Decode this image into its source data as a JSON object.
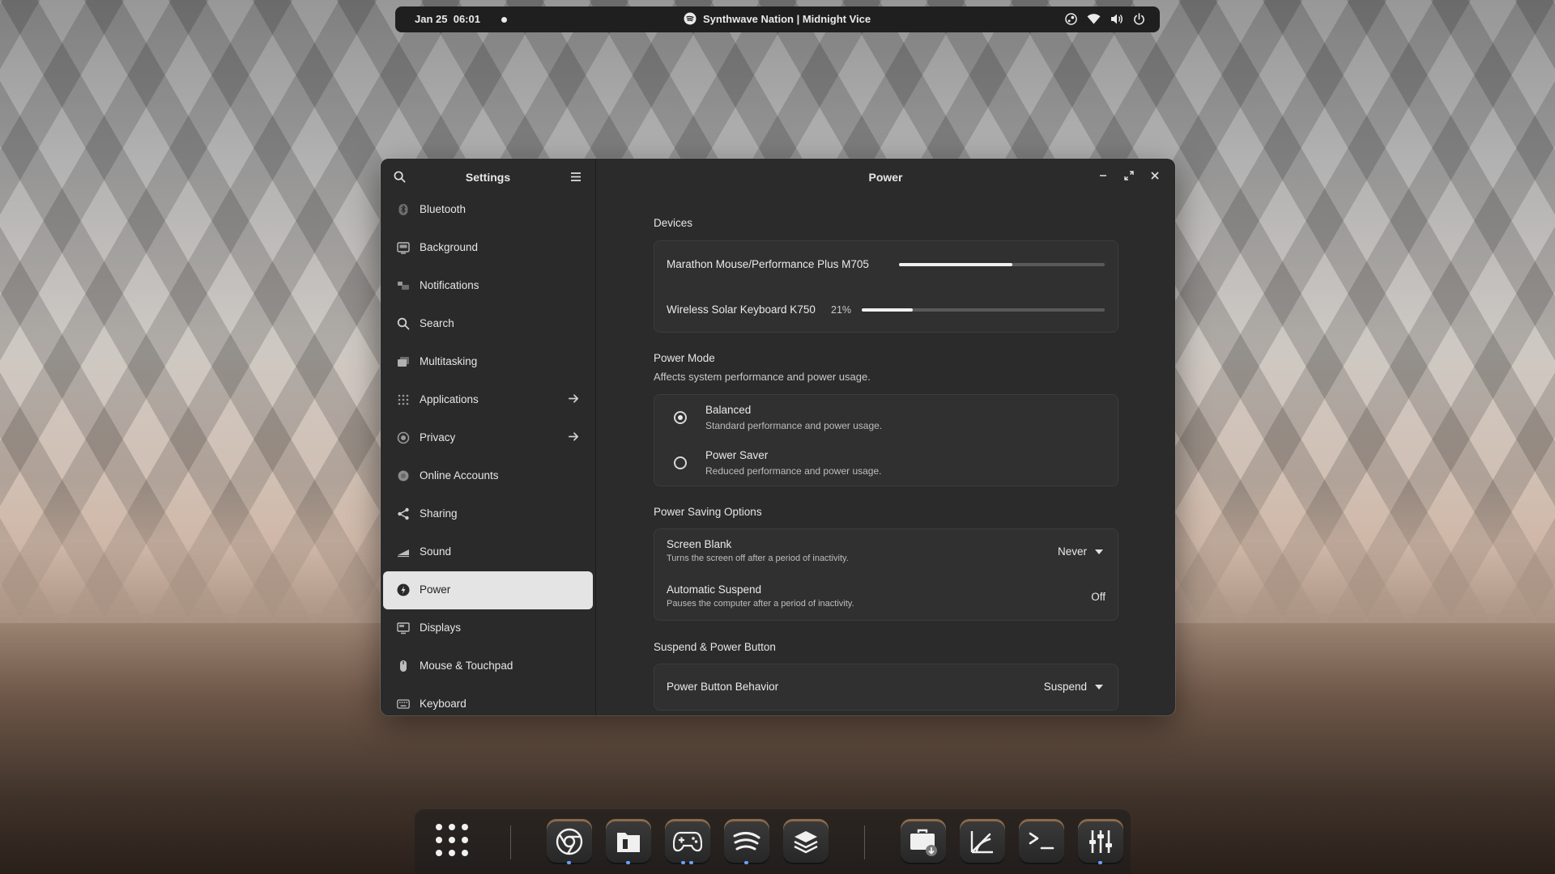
{
  "topbar": {
    "date": "Jan 25",
    "time": "06:01",
    "now_playing": "Synthwave Nation | Midnight Vice",
    "icons": [
      "steam-icon",
      "wifi-icon",
      "volume-icon",
      "power-icon"
    ]
  },
  "sidebar": {
    "title": "Settings",
    "items": [
      {
        "label": "Bluetooth",
        "icon": "bluetooth-icon"
      },
      {
        "label": "Background",
        "icon": "background-icon"
      },
      {
        "label": "Notifications",
        "icon": "notifications-icon"
      },
      {
        "label": "Search",
        "icon": "search-icon"
      },
      {
        "label": "Multitasking",
        "icon": "multitasking-icon"
      },
      {
        "label": "Applications",
        "icon": "applications-icon"
      },
      {
        "label": "Privacy",
        "icon": "privacy-icon"
      },
      {
        "label": "Online Accounts",
        "icon": "online-accounts-icon"
      },
      {
        "label": "Sharing",
        "icon": "sharing-icon"
      },
      {
        "label": "Sound",
        "icon": "sound-icon"
      },
      {
        "label": "Power",
        "icon": "power-icon"
      },
      {
        "label": "Displays",
        "icon": "displays-icon"
      },
      {
        "label": "Mouse & Touchpad",
        "icon": "mouse-icon"
      },
      {
        "label": "Keyboard",
        "icon": "keyboard-icon"
      }
    ],
    "active": "Power"
  },
  "main": {
    "title": "Power",
    "devices": {
      "title": "Devices",
      "items": [
        {
          "name": "Marathon Mouse/Performance Plus M705",
          "percent_label": "",
          "level": 0.55
        },
        {
          "name": "Wireless Solar Keyboard K750",
          "percent_label": "21%",
          "level": 0.21
        }
      ]
    },
    "power_mode": {
      "title": "Power Mode",
      "subtitle": "Affects system performance and power usage.",
      "options": [
        {
          "label": "Balanced",
          "desc": "Standard performance and power usage.",
          "selected": true
        },
        {
          "label": "Power Saver",
          "desc": "Reduced performance and power usage.",
          "selected": false
        }
      ]
    },
    "saving": {
      "title": "Power Saving Options",
      "screen_blank": {
        "label": "Screen Blank",
        "desc": "Turns the screen off after a period of inactivity.",
        "value": "Never"
      },
      "auto_suspend": {
        "label": "Automatic Suspend",
        "desc": "Pauses the computer after a period of inactivity.",
        "value": "Off"
      }
    },
    "suspend": {
      "title": "Suspend & Power Button",
      "power_button": {
        "label": "Power Button Behavior",
        "value": "Suspend"
      }
    }
  },
  "dock": {
    "apps": [
      "app-grid-icon",
      "chrome-icon",
      "files-icon",
      "gamepad-icon",
      "spotify-icon",
      "layers-icon",
      "software-install-icon",
      "krita-icon",
      "terminal-icon",
      "mixer-icon"
    ]
  },
  "colors": {
    "topbar_bg": "#1f1f1f",
    "window_bg": "#2b2b2b",
    "active_item_bg": "#e4e4e4",
    "accent_bar": "#f0f0f0"
  }
}
